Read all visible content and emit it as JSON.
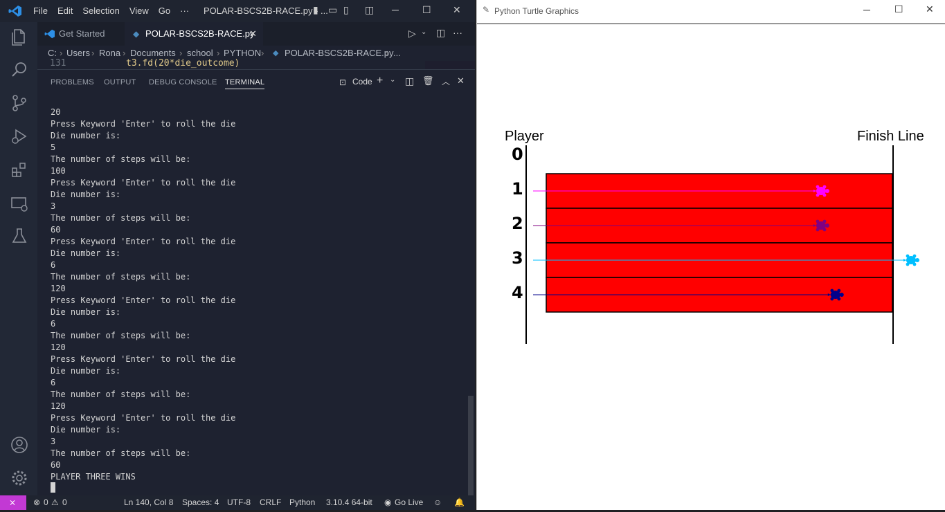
{
  "vscode": {
    "menu": [
      "File",
      "Edit",
      "Selection",
      "View",
      "Go",
      "···"
    ],
    "window_title": "POLAR-BSCS2B-RACE.py - ...",
    "tabs": [
      {
        "label": "Get Started"
      },
      {
        "label": "POLAR-BSCS2B-RACE.py"
      }
    ],
    "breadcrumb": [
      "C:",
      "Users",
      "Rona",
      "Documents",
      "school",
      "PYTHON",
      "POLAR-BSCS2B-RACE.py",
      "..."
    ],
    "code_line_number": "131",
    "code_line": "t3.fd(20*die_outcome)",
    "panel_tabs": [
      "PROBLEMS",
      "OUTPUT",
      "DEBUG CONSOLE",
      "TERMINAL"
    ],
    "terminal_profile": "Code",
    "terminal_lines": [
      "20",
      "Press Keyword 'Enter' to roll the die",
      "Die number is:",
      "5",
      "The number of steps will be:",
      "100",
      "Press Keyword 'Enter' to roll the die",
      "Die number is:",
      "3",
      "The number of steps will be:",
      "60",
      "Press Keyword 'Enter' to roll the die",
      "Die number is:",
      "6",
      "The number of steps will be:",
      "120",
      "Press Keyword 'Enter' to roll the die",
      "Die number is:",
      "6",
      "The number of steps will be:",
      "120",
      "Press Keyword 'Enter' to roll the die",
      "Die number is:",
      "6",
      "The number of steps will be:",
      "120",
      "Press Keyword 'Enter' to roll the die",
      "Die number is:",
      "3",
      "The number of steps will be:",
      "60",
      "PLAYER THREE WINS"
    ],
    "status": {
      "errors": "0",
      "warnings": "0",
      "position": "Ln 140, Col 8",
      "spaces": "Spaces: 4",
      "encoding": "UTF-8",
      "eol": "CRLF",
      "language": "Python",
      "interpreter": "3.10.4 64-bit",
      "golive": "Go Live"
    }
  },
  "turtle": {
    "window_title": "Python Turtle Graphics",
    "player_label": "Player",
    "finish_label": "Finish Line",
    "lane_numbers": [
      "0",
      "1",
      "2",
      "3",
      "4"
    ],
    "track_color": "#ff0000",
    "turtles": [
      {
        "lane": "1",
        "color": "#ff00ff",
        "progress": 0.8
      },
      {
        "lane": "2",
        "color": "#800080",
        "progress": 0.8
      },
      {
        "lane": "3",
        "color": "#00bfff",
        "progress": 1.05
      },
      {
        "lane": "4",
        "color": "#00008b",
        "progress": 0.84
      }
    ]
  }
}
